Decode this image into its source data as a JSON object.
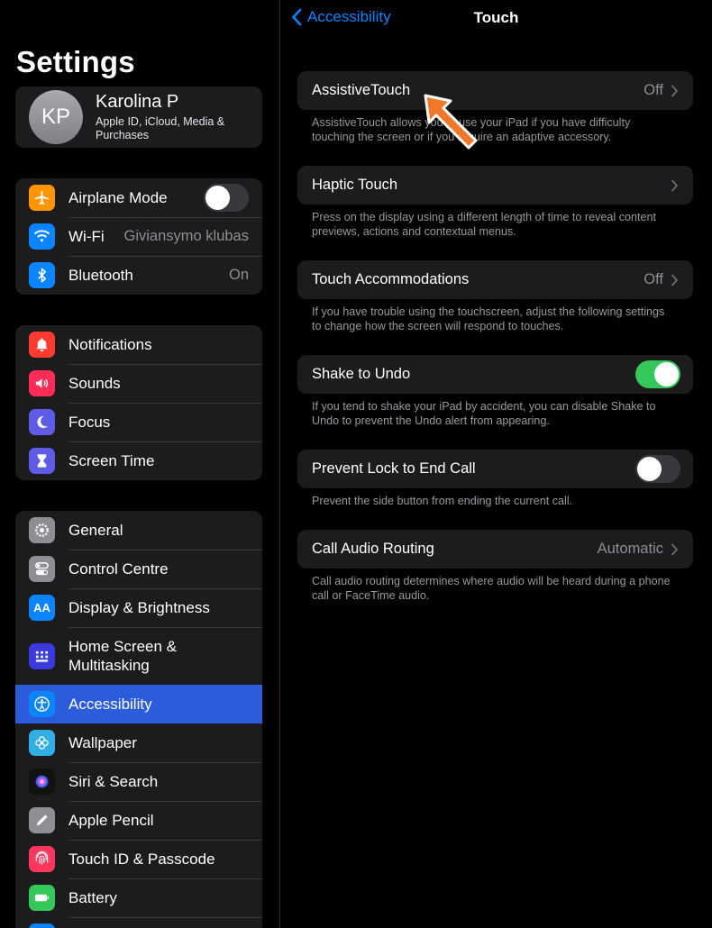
{
  "sidebar": {
    "title": "Settings",
    "profile": {
      "initials": "KP",
      "name": "Karolina P",
      "subtitle": "Apple ID, iCloud, Media & Purchases"
    },
    "connectivity": [
      {
        "label": "Airplane Mode",
        "icon": "airplane-icon",
        "color": "#ff9500",
        "toggle": false
      },
      {
        "label": "Wi-Fi",
        "icon": "wifi-icon",
        "color": "#0a84ff",
        "value": "Giviansymo klubas"
      },
      {
        "label": "Bluetooth",
        "icon": "bluetooth-icon",
        "color": "#0a84ff",
        "value": "On"
      }
    ],
    "notifications_group": [
      {
        "label": "Notifications",
        "icon": "bell-icon",
        "color": "#ff3b30"
      },
      {
        "label": "Sounds",
        "icon": "speaker-icon",
        "color": "#ff2d55"
      },
      {
        "label": "Focus",
        "icon": "moon-icon",
        "color": "#5e5ce6"
      },
      {
        "label": "Screen Time",
        "icon": "hourglass-icon",
        "color": "#5e5ce6"
      }
    ],
    "general_group": [
      {
        "label": "General",
        "icon": "gear-icon",
        "color": "#8e8e93"
      },
      {
        "label": "Control Centre",
        "icon": "switches-icon",
        "color": "#8e8e93"
      },
      {
        "label": "Display & Brightness",
        "icon": "text-size-icon",
        "color": "#0a84ff"
      },
      {
        "label": "Home Screen &\nMultitasking",
        "icon": "app-grid-icon",
        "color": "#3a3adf"
      },
      {
        "label": "Accessibility",
        "icon": "accessibility-icon",
        "color": "#0a84ff",
        "selected": true
      },
      {
        "label": "Wallpaper",
        "icon": "flower-icon",
        "color": "#32ade6"
      },
      {
        "label": "Siri & Search",
        "icon": "siri-icon",
        "color": "#222"
      },
      {
        "label": "Apple Pencil",
        "icon": "pencil-icon",
        "color": "#8e8e93"
      },
      {
        "label": "Touch ID & Passcode",
        "icon": "fingerprint-icon",
        "color": "#ff375f"
      },
      {
        "label": "Battery",
        "icon": "battery-icon",
        "color": "#34c759"
      }
    ]
  },
  "detail": {
    "back_label": "Accessibility",
    "title": "Touch",
    "items": [
      {
        "label": "AssistiveTouch",
        "value": "Off",
        "chevron": true,
        "footnote": "AssistiveTouch allows you to use your iPad if you have difficulty touching the screen or if you require an adaptive accessory."
      },
      {
        "label": "Haptic Touch",
        "value": "",
        "chevron": true,
        "footnote": "Press on the display using a different length of time to reveal content previews, actions and contextual menus."
      },
      {
        "label": "Touch Accommodations",
        "value": "Off",
        "chevron": true,
        "footnote": "If you have trouble using the touchscreen, adjust the following settings to change how the screen will respond to touches."
      },
      {
        "label": "Shake to Undo",
        "toggle": true,
        "footnote": "If you tend to shake your iPad by accident, you can disable Shake to Undo to prevent the Undo alert from appearing."
      },
      {
        "label": "Prevent Lock to End Call",
        "toggle": false,
        "footnote": "Prevent the side button from ending the current call."
      },
      {
        "label": "Call Audio Routing",
        "value": "Automatic",
        "chevron": true,
        "footnote": "Call audio routing determines where audio will be heard during a phone call or FaceTime audio."
      }
    ]
  },
  "colors": {
    "accent": "#0a84ff",
    "selected_row": "#2a5cdb",
    "toggle_on": "#34c759",
    "annotation_arrow": "#f0782a"
  }
}
